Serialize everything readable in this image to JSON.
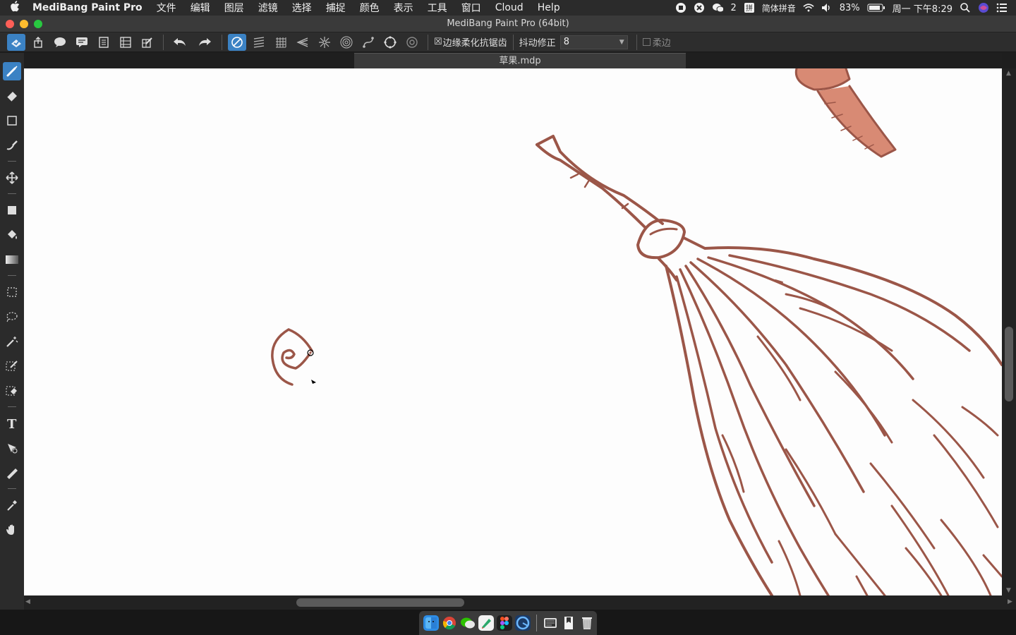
{
  "menubar": {
    "app_name": "MediBang Paint Pro",
    "menus": [
      "文件",
      "编辑",
      "图层",
      "滤镜",
      "选择",
      "捕捉",
      "颜色",
      "表示",
      "工具",
      "窗口",
      "Cloud",
      "Help"
    ],
    "wechat_count": "2",
    "input_method": "简体拼音",
    "battery": "83%",
    "clock": "周一 下午8:29"
  },
  "window": {
    "title": "MediBang Paint Pro (64bit)"
  },
  "toolbar": {
    "antialias_label": "边缘柔化抗锯齿",
    "antialias_checked": "☒",
    "stabilizer_label": "抖动修正",
    "stabilizer_value": "8",
    "soft_edge_label": "柔边"
  },
  "document": {
    "tab_title": "草果.mdp"
  },
  "colors": {
    "accent": "#3b82c4",
    "stroke": "#9b5648",
    "broom_binding": "#d88a74"
  },
  "tools": [
    "brush-tool",
    "eraser-tool",
    "dot-tool",
    "select-pen-tool",
    "move-tool",
    "shape-fill-tool",
    "bucket-tool",
    "gradient-tool",
    "selection-tool",
    "lasso-tool",
    "magic-wand-tool",
    "select-pen-tool-2",
    "select-eraser-tool",
    "text-tool",
    "operation-tool",
    "divide-tool",
    "eyedropper-tool",
    "hand-tool"
  ],
  "dock": [
    "finder",
    "chrome",
    "wechat",
    "medibang",
    "figma",
    "browser",
    "preview",
    "notes",
    "trash"
  ]
}
